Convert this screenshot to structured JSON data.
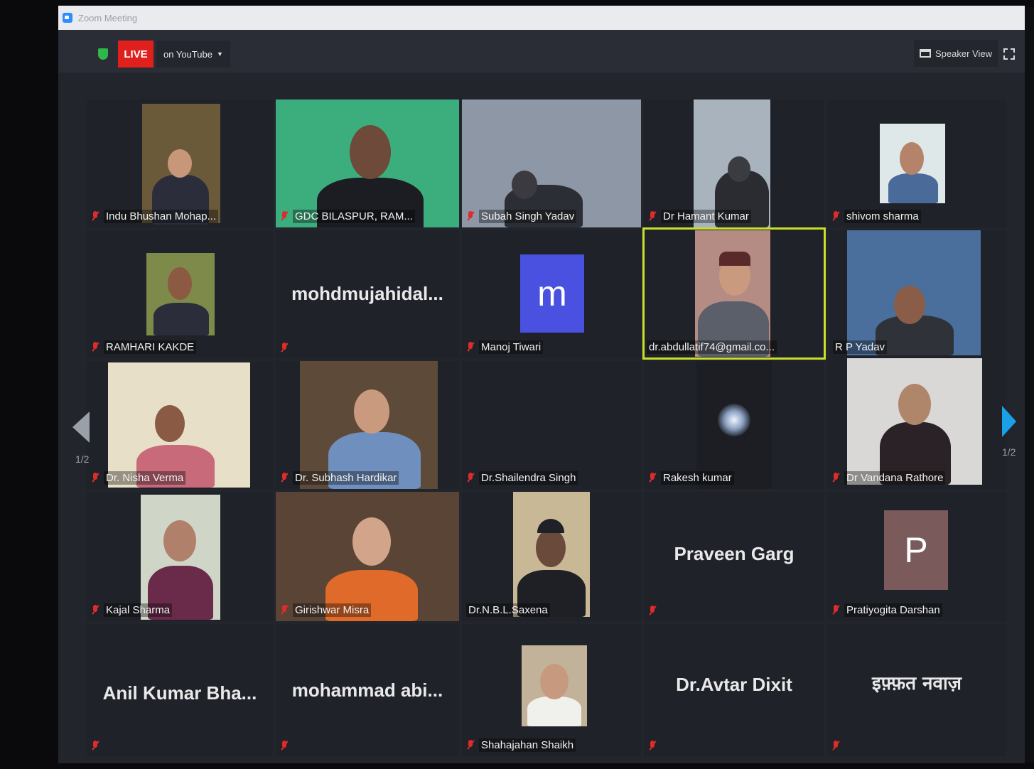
{
  "window": {
    "title": "Zoom Meeting"
  },
  "toolbar": {
    "live_badge": "LIVE",
    "live_on": "on YouTube",
    "speaker_view": "Speaker View",
    "page_left": "1/2",
    "page_right": "1/2"
  },
  "tiles": [
    {
      "name": "Indu Bhushan Mohap...",
      "kind": "video",
      "muted": true
    },
    {
      "name": "GDC BILASPUR, RAM...",
      "kind": "video",
      "muted": true
    },
    {
      "name": "Subah Singh Yadav",
      "kind": "video",
      "muted": true
    },
    {
      "name": "Dr Hamant Kumar",
      "kind": "video",
      "muted": true
    },
    {
      "name": "shivom sharma",
      "kind": "video",
      "muted": true
    },
    {
      "name": "RAMHARI KAKDE",
      "kind": "video",
      "muted": true
    },
    {
      "name": "mohdmujahidal...",
      "kind": "text",
      "muted": true
    },
    {
      "name": "Manoj Tiwari",
      "kind": "avatar",
      "avatar_letter": "m",
      "avatar_color": "#4a50e0",
      "muted": true
    },
    {
      "name": "dr.abdullatif74@gmail.co...",
      "kind": "video",
      "muted": false,
      "active_speaker": true
    },
    {
      "name": "R P Yadav",
      "kind": "video",
      "muted": false
    },
    {
      "name": "Dr. Nisha Verma",
      "kind": "video",
      "muted": true
    },
    {
      "name": "Dr. Subhash Hardikar",
      "kind": "video",
      "muted": true
    },
    {
      "name": "Dr.Shailendra Singh",
      "kind": "blank",
      "muted": true
    },
    {
      "name": "Rakesh kumar",
      "kind": "video",
      "muted": true
    },
    {
      "name": "Dr Vandana Rathore",
      "kind": "video",
      "muted": true
    },
    {
      "name": "Kajal Sharma",
      "kind": "video",
      "muted": true
    },
    {
      "name": "Girishwar Misra",
      "kind": "video",
      "muted": true
    },
    {
      "name": "Dr.N.B.L.Saxena",
      "kind": "video",
      "muted": false
    },
    {
      "name": "Praveen Garg",
      "kind": "text",
      "muted": true
    },
    {
      "name": "Pratiyogita Darshan",
      "kind": "avatar",
      "avatar_letter": "P",
      "avatar_color": "#7a5a5a",
      "muted": true
    },
    {
      "name": "Anil Kumar Bha...",
      "kind": "text",
      "muted": true
    },
    {
      "name": "mohammad abi...",
      "kind": "text",
      "muted": true
    },
    {
      "name": "Shahajahan Shaikh",
      "kind": "video",
      "muted": true
    },
    {
      "name": "Dr.Avtar Dixit",
      "kind": "text",
      "muted": true
    },
    {
      "name": "इफ़्फ़त नवाज़",
      "kind": "text",
      "muted": true
    }
  ]
}
